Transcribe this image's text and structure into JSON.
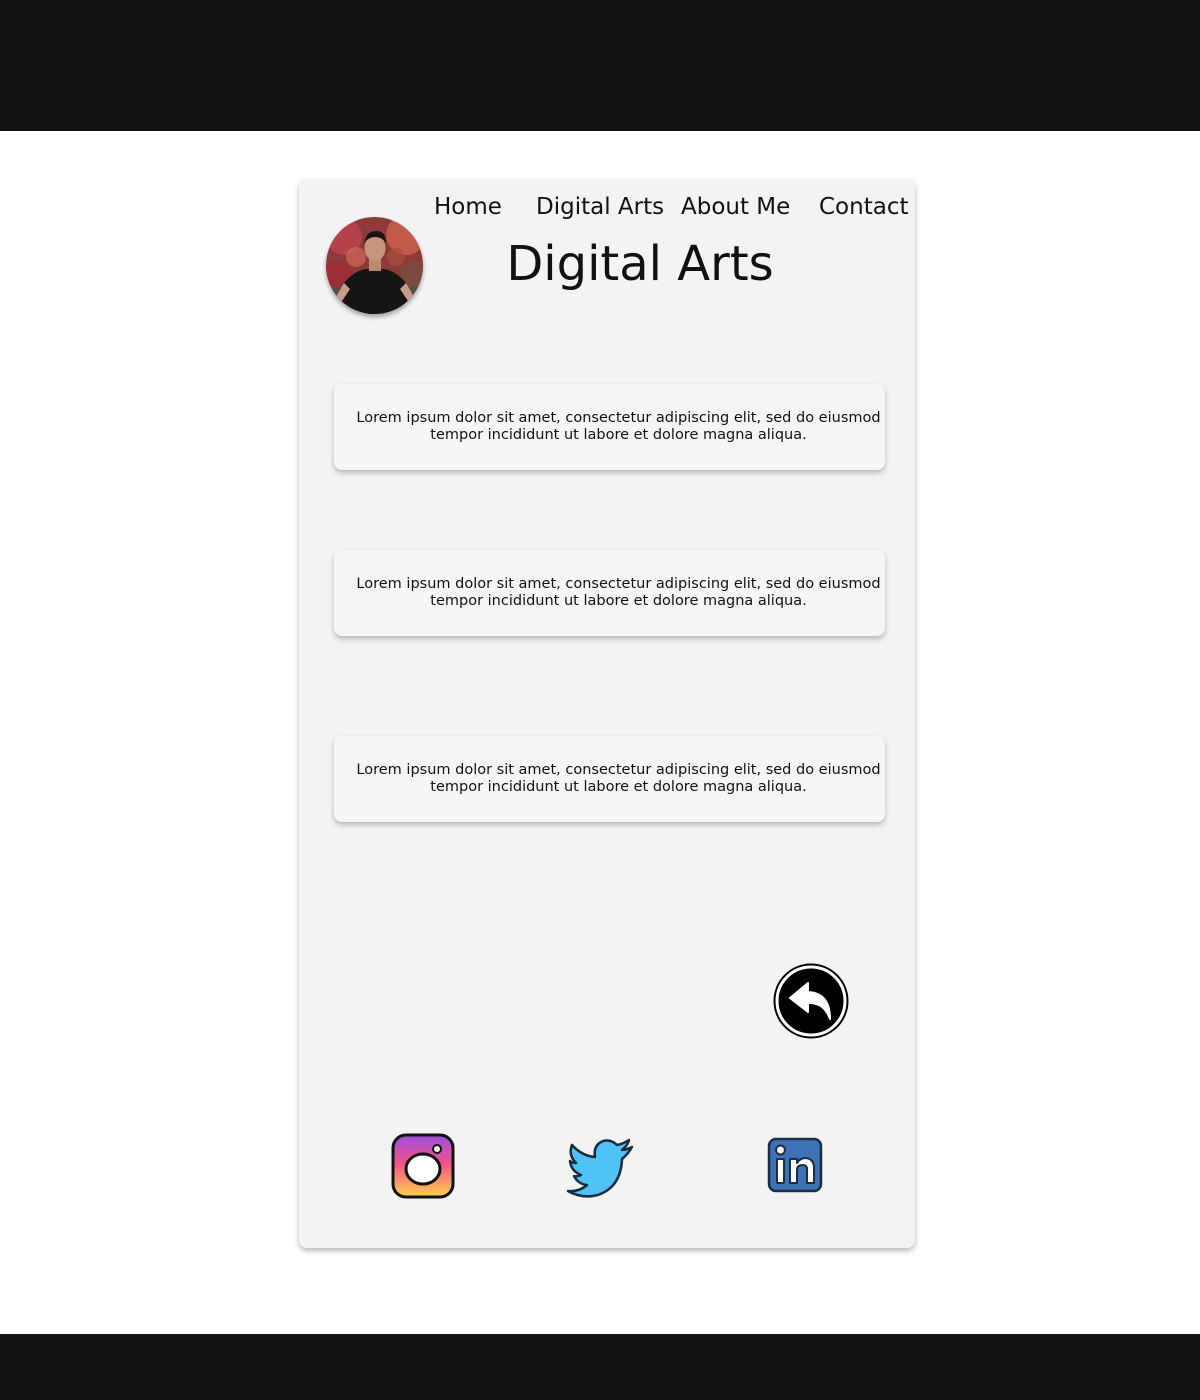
{
  "nav": {
    "items": [
      {
        "label": "Home"
      },
      {
        "label": "Digital Arts"
      },
      {
        "label": "About Me"
      },
      {
        "label": "Contact"
      }
    ]
  },
  "page": {
    "title": "Digital Arts"
  },
  "cards": [
    {
      "text": "Lorem ipsum dolor sit amet, consectetur adipiscing elit, sed do eiusmod tempor incididunt ut labore et dolore magna aliqua."
    },
    {
      "text": "Lorem ipsum dolor sit amet, consectetur adipiscing elit, sed do eiusmod tempor incididunt ut labore et dolore magna aliqua."
    },
    {
      "text": "Lorem ipsum dolor sit amet, consectetur adipiscing elit, sed do eiusmod tempor incididunt ut labore et dolore magna aliqua."
    }
  ],
  "icons": {
    "back": "back-arrow-icon",
    "social": [
      "instagram-icon",
      "twitter-icon",
      "linkedin-icon"
    ]
  },
  "colors": {
    "frame_bars": "#111111",
    "card_background": "#f4f3f3",
    "twitter_blue": "#4fc3f7",
    "linkedin_blue": "#3d72b4"
  }
}
